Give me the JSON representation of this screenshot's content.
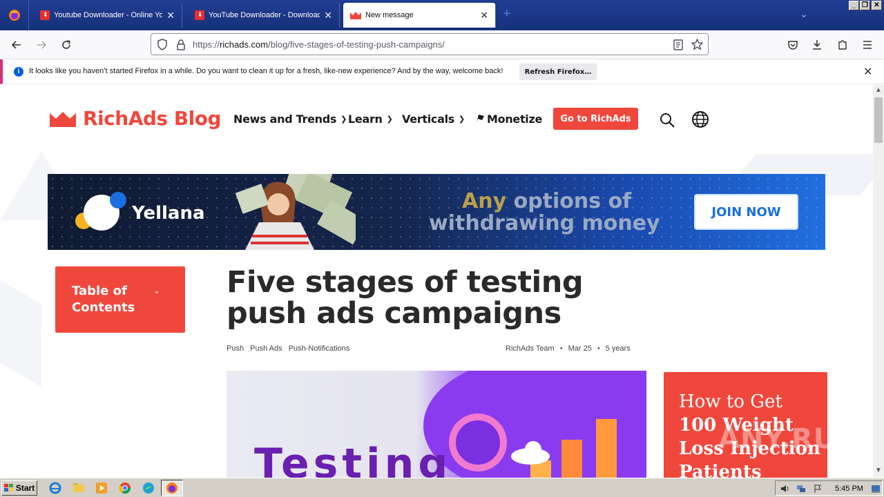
{
  "browser": {
    "tabs": [
      {
        "title": "Youtube Downloader - Online Youtube",
        "active": false
      },
      {
        "title": "YouTube Downloader - Download Youtube",
        "active": false
      },
      {
        "title": "New message",
        "active": true
      }
    ],
    "new_tab_label": "+",
    "url": {
      "prefix": "https://",
      "host": "richads.com",
      "path": "/blog/five-stages-of-testing-push-campaigns/"
    }
  },
  "notification": {
    "message": "It looks like you haven’t started Firefox in a while. Do you want to clean it up for a fresh, like-new experience? And by the way, welcome back!",
    "button": "Refresh Firefox…"
  },
  "site": {
    "logo_text": "RichAds Blog",
    "nav": [
      {
        "label": "News and Trends",
        "has_dropdown": true
      },
      {
        "label": "Learn",
        "has_dropdown": true
      },
      {
        "label": "Verticals",
        "has_dropdown": true
      },
      {
        "label": "Monetize",
        "has_dropdown": false
      }
    ],
    "cta": "Go to RichAds"
  },
  "banner": {
    "brand": "Yellana",
    "headline_any": "Any",
    "headline_rest": " options of",
    "headline_line2": "withdrawing money",
    "button": "JOIN NOW"
  },
  "toc": {
    "label": "Table of Contents"
  },
  "article": {
    "title": "Five stages of testing push ads campaigns",
    "tags": [
      "Push",
      "Push Ads",
      "Push-Notifications"
    ],
    "author": "RichAds Team",
    "date": "Mar 25",
    "age": "5 years",
    "hero_word": "Testing"
  },
  "side_ad": {
    "line1": "How to Get",
    "line2": "100 Weight Loss Injection Patients"
  },
  "watermark": "ANY.RUN",
  "taskbar": {
    "start": "Start",
    "clock": "5:45 PM"
  },
  "colors": {
    "brand_red": "#f0473c",
    "firefox_blue": "#0060df"
  }
}
